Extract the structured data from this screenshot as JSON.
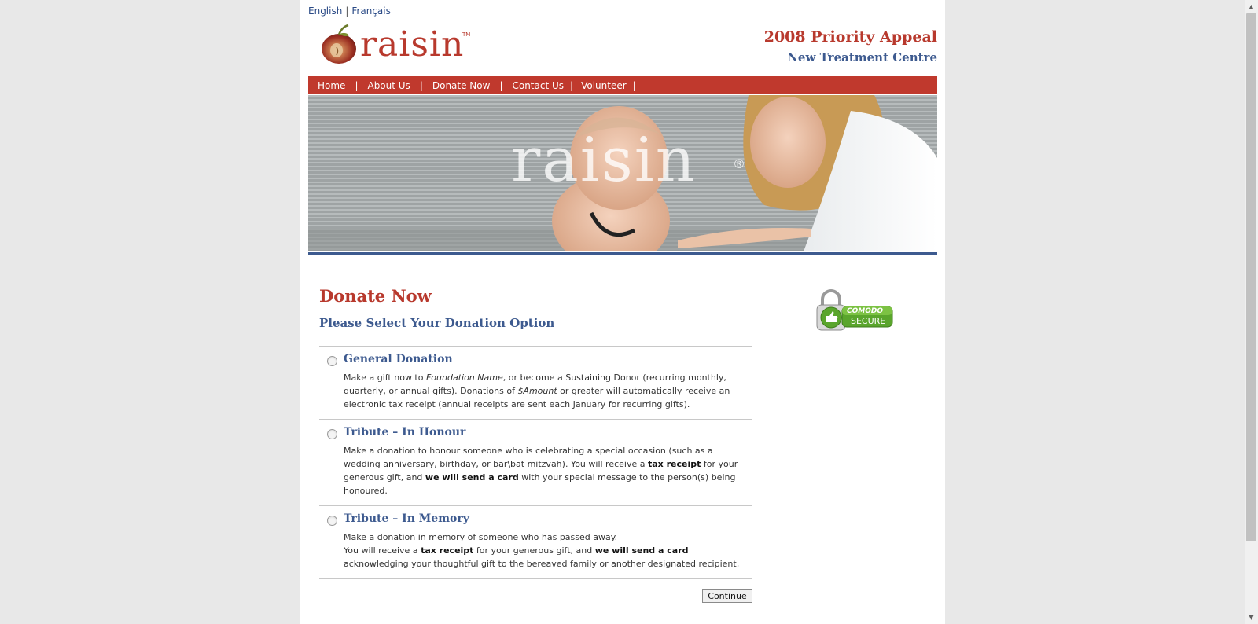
{
  "language": {
    "english": "English",
    "separator": "|",
    "french": "Français"
  },
  "logo": {
    "text": "raisin",
    "tm": "TM"
  },
  "appeal": {
    "title": "2008 Priority Appeal",
    "subtitle": "New Treatment Centre"
  },
  "nav": {
    "items": [
      "Home",
      "About Us",
      "Donate Now",
      "Contact Us",
      "Volunteer"
    ],
    "separator": "|"
  },
  "hero": {
    "watermark": "raisin",
    "registered": "®"
  },
  "main": {
    "title": "Donate Now",
    "subtitle": "Please Select Your Donation Option",
    "options": [
      {
        "title": "General Donation",
        "desc_1": "Make a gift now to ",
        "desc_2": "Foundation Name",
        "desc_3": ", or become a Sustaining Donor (recurring monthly, quarterly, or annual gifts). Donations of ",
        "desc_4": "$Amount",
        "desc_5": " or greater will automatically receive an electronic tax receipt (annual receipts are sent each January for recurring gifts)."
      },
      {
        "title": "Tribute – In Honour",
        "desc_1": "Make a donation to honour someone who is celebrating a special occasion (such as a wedding anniversary, birthday, or bar\\bat mitzvah). You will receive a ",
        "desc_2": "tax receipt",
        "desc_3": " for your generous gift, and ",
        "desc_4": "we will send a card",
        "desc_5": " with your special message to the person(s) being honoured."
      },
      {
        "title": "Tribute – In Memory",
        "desc_1": "Make a donation in memory of someone who has passed away.",
        "desc_2": "You will receive a ",
        "desc_3": "tax receipt",
        "desc_4": " for your generous gift, and ",
        "desc_5": "we will send a card",
        "desc_6": "acknowledging your thoughtful gift to the bereaved family or another designated recipient,"
      }
    ],
    "continue_label": "Continue"
  },
  "seal": {
    "line1": "COMODO",
    "line2": "SECURE"
  },
  "colors": {
    "brand_red": "#c0392d",
    "brand_blue": "#3d5a8f"
  }
}
